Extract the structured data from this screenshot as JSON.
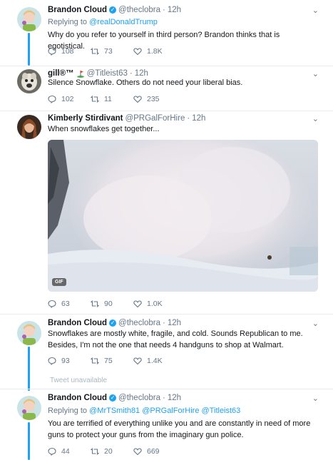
{
  "colors": {
    "accent": "#1da1f2",
    "muted": "#657786",
    "text": "#14171a"
  },
  "tweets": [
    {
      "name": "Brandon Cloud",
      "verified": true,
      "handle": "@theclobra",
      "time": "12h",
      "reply_label": "Replying to",
      "reply_to": "@realDonaldTrump",
      "text": "Why do you refer to yourself in third person? Brandon thinks that is egotistical.",
      "replies": "108",
      "retweets": "73",
      "likes": "1.8K"
    },
    {
      "name": "gill®™",
      "golf_icon": "golf-flag-icon",
      "handle": "@Titleist63",
      "time": "12h",
      "text": "Silence Snowflake. Others do not need your liberal bias.",
      "replies": "102",
      "retweets": "11",
      "likes": "235"
    },
    {
      "name": "Kimberly Stirdivant",
      "handle": "@PRGalForHire",
      "time": "12h",
      "text": "When snowflakes get together...",
      "media_badge": "GIF",
      "replies": "63",
      "retweets": "90",
      "likes": "1.0K"
    },
    {
      "name": "Brandon Cloud",
      "verified": true,
      "handle": "@theclobra",
      "time": "12h",
      "text": "Snowflakes are mostly white, fragile, and cold. Sounds Republican to me. Besides, I'm not the one that needs 4 handguns to shop at Walmart.",
      "replies": "93",
      "retweets": "75",
      "likes": "1.4K"
    },
    {
      "name": "Brandon Cloud",
      "verified": true,
      "handle": "@theclobra",
      "time": "12h",
      "reply_label": "Replying to",
      "reply_to": "@MrTSmith81 @PRGalForHire @Titleist63",
      "text": "You are terrified of everything unlike you and are constantly in need of more guns to protect your guns from the imaginary gun police.",
      "replies": "44",
      "retweets": "20",
      "likes": "669"
    }
  ],
  "unavailable_text": "Tweet unavailable"
}
